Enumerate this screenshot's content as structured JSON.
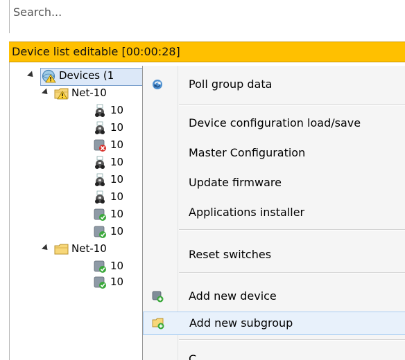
{
  "search": {
    "placeholder": "Search..."
  },
  "status_bar": {
    "text": "Device list editable [00:00:28]",
    "color": "#ffc000"
  },
  "tree": {
    "root_label": "Devices (1",
    "groups": [
      {
        "label": "Net-10"
      },
      {
        "label": "Net-10"
      }
    ],
    "device_label": "10"
  },
  "context_menu": {
    "items": [
      {
        "label": "Poll group data",
        "icon": "refresh-icon"
      },
      {
        "label": "Device configuration load/save"
      },
      {
        "label": "Master Configuration"
      },
      {
        "label": "Update firmware"
      },
      {
        "label": "Applications installer"
      },
      {
        "label": "Reset switches"
      },
      {
        "label": "Add new device",
        "icon": "add-device-icon"
      },
      {
        "label": "Add new subgroup",
        "icon": "add-folder-icon"
      },
      {
        "label": "C"
      }
    ]
  }
}
